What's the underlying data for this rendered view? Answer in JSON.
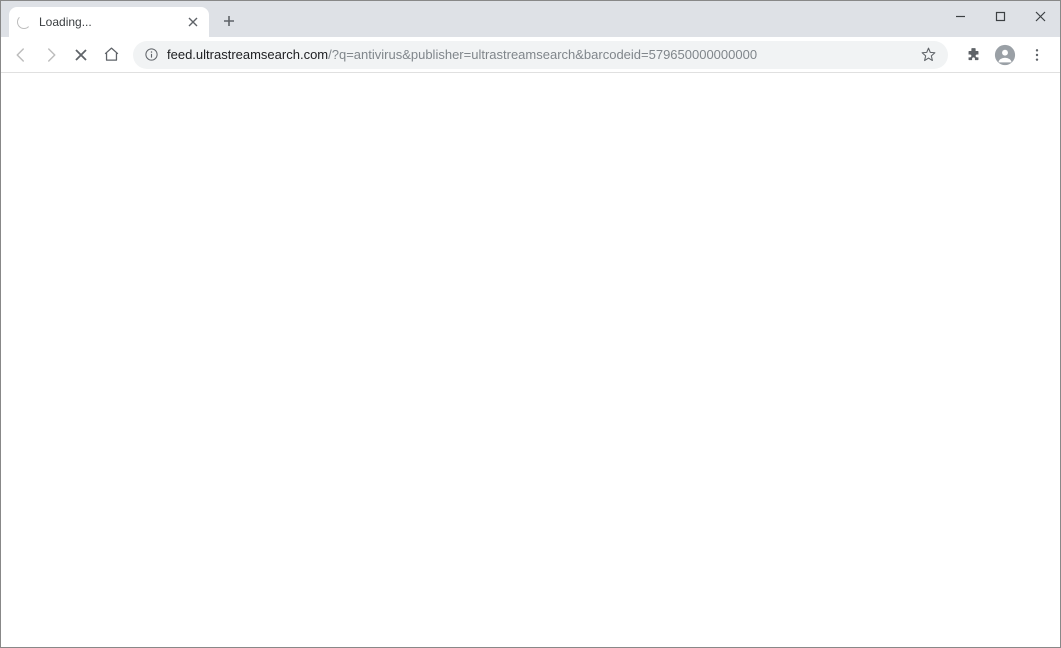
{
  "tab": {
    "title": "Loading..."
  },
  "address": {
    "host": "feed.ultrastreamsearch.com",
    "path": "/?q=antivirus&publisher=ultrastreamsearch&barcodeid=579650000000000"
  }
}
